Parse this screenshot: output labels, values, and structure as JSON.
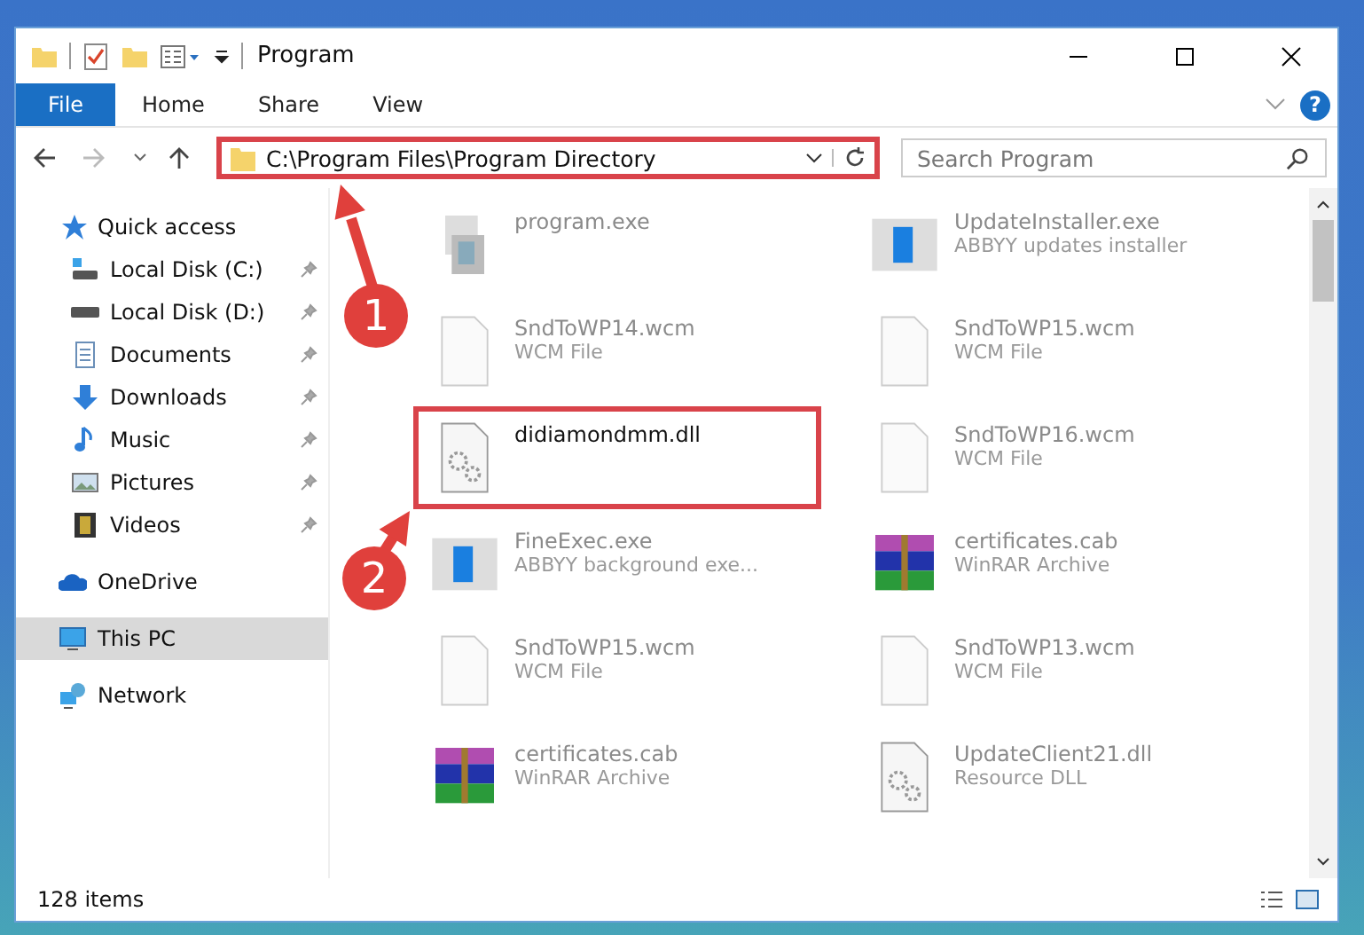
{
  "window": {
    "title": "Program"
  },
  "ribbon": {
    "tabs": [
      {
        "label": "File",
        "selected": true
      },
      {
        "label": "Home",
        "selected": false
      },
      {
        "label": "Share",
        "selected": false
      },
      {
        "label": "View",
        "selected": false
      }
    ],
    "help": "?"
  },
  "address": {
    "path": "C:\\Program Files\\Program Directory",
    "highlighted": true
  },
  "search": {
    "placeholder": "Search Program"
  },
  "sidebar": {
    "items": [
      {
        "label": "Quick access",
        "kind": "star",
        "selected": false,
        "children": [
          {
            "label": "Local Disk (C:)",
            "kind": "disk-c",
            "pinned": true,
            "selected": false
          },
          {
            "label": "Local Disk (D:)",
            "kind": "disk",
            "pinned": true,
            "selected": false
          },
          {
            "label": "Documents",
            "kind": "doc",
            "pinned": true,
            "selected": false
          },
          {
            "label": "Downloads",
            "kind": "down",
            "pinned": true,
            "selected": false
          },
          {
            "label": "Music",
            "kind": "music",
            "pinned": true,
            "selected": false
          },
          {
            "label": "Pictures",
            "kind": "pic",
            "pinned": true,
            "selected": false
          },
          {
            "label": "Videos",
            "kind": "video",
            "pinned": true,
            "selected": false
          }
        ]
      },
      {
        "label": "OneDrive",
        "kind": "cloud",
        "selected": false
      },
      {
        "label": "This PC",
        "kind": "pc",
        "selected": true
      },
      {
        "label": "Network",
        "kind": "net",
        "selected": false
      }
    ]
  },
  "files": [
    {
      "name": "program.exe",
      "kind": "exe",
      "highlighted": false
    },
    {
      "name": "UpdateInstaller.exe",
      "type": "ABBYY updates installer",
      "kind": "app",
      "highlighted": false
    },
    {
      "name": "SndToWP14.wcm",
      "type": "WCM File",
      "kind": "blank",
      "highlighted": false
    },
    {
      "name": "SndToWP15.wcm",
      "type": "WCM File",
      "kind": "blank",
      "highlighted": false
    },
    {
      "name": "didiamondmm.dll",
      "kind": "dll",
      "highlighted": true
    },
    {
      "name": "SndToWP16.wcm",
      "type": "WCM File",
      "kind": "blank",
      "highlighted": false
    },
    {
      "name": "FineExec.exe",
      "type": "ABBYY background exe...",
      "kind": "app",
      "highlighted": false
    },
    {
      "name": "certificates.cab",
      "type": "WinRAR Archive",
      "kind": "rar",
      "highlighted": false
    },
    {
      "name": "SndToWP15.wcm",
      "type": "WCM File",
      "kind": "blank",
      "highlighted": false
    },
    {
      "name": "SndToWP13.wcm",
      "type": "WCM File",
      "kind": "blank",
      "highlighted": false
    },
    {
      "name": "certificates.cab",
      "type": "WinRAR Archive",
      "kind": "rar",
      "highlighted": false
    },
    {
      "name": "UpdateClient21.dll",
      "type": "Resource DLL",
      "kind": "dll",
      "highlighted": false
    }
  ],
  "callouts": [
    {
      "number": "1"
    },
    {
      "number": "2"
    }
  ],
  "status_bar": {
    "count": "128 items"
  }
}
